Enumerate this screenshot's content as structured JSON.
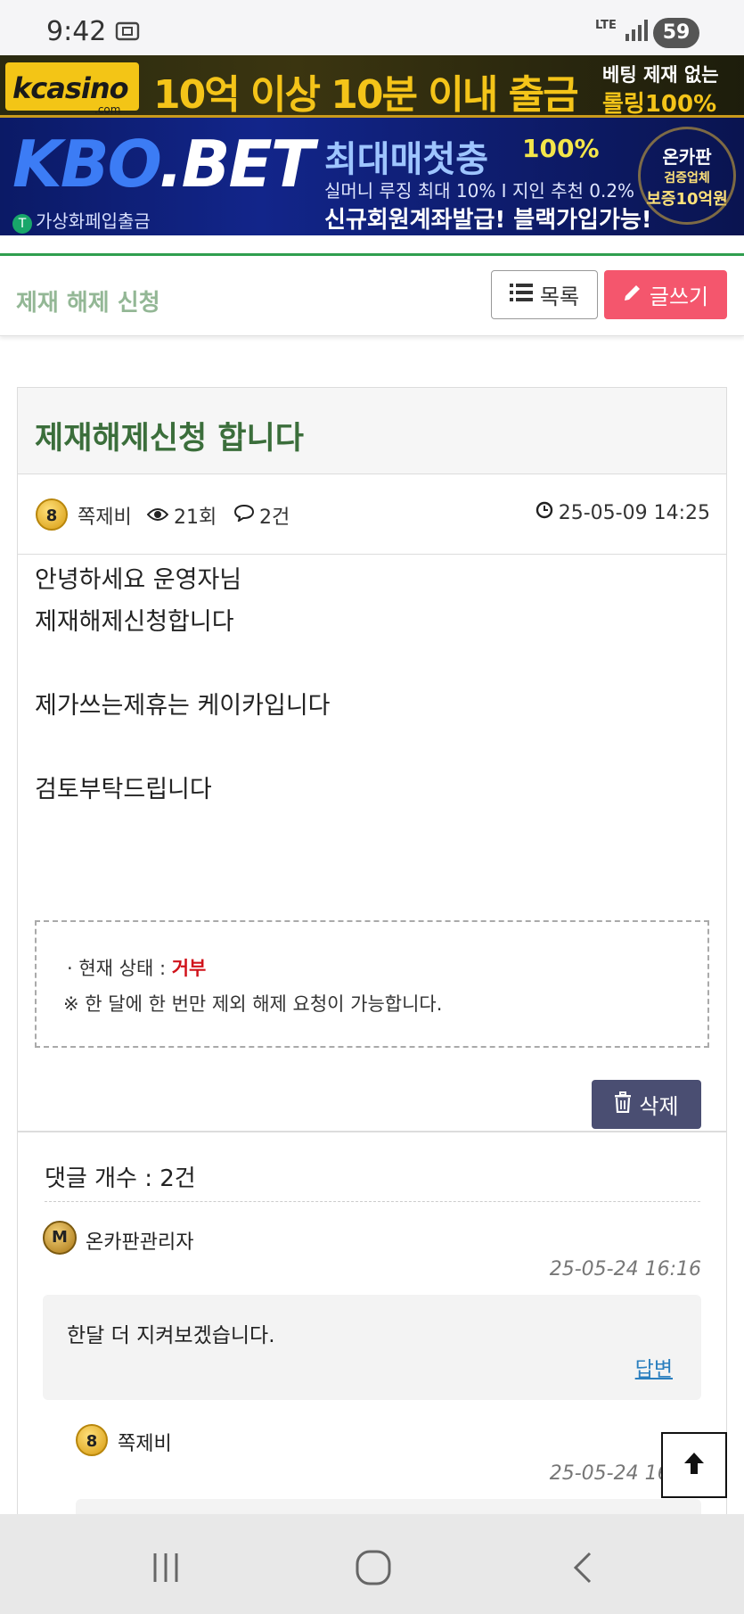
{
  "status_bar": {
    "time": "9:42",
    "network": "LTE",
    "battery": "59",
    "icons": [
      "screenshot-icon",
      "signal-icon"
    ]
  },
  "banners": {
    "top": {
      "logo": "kcasino",
      "logo_sub": ".com",
      "headline": "10억 이상 10분 이내 출금",
      "right_line1": "베팅 제재 없는",
      "right_line2": "롤링100%"
    },
    "second": {
      "brand_a": "KBO",
      "brand_b": ".BET",
      "tagline": "가상화페입출금",
      "headline": "최대매첫충",
      "percent": "100%",
      "subline": "실머니 루징 최대 10% I 지인 추천 0.2%",
      "cta": "신규회원계좌발급! 블랙가입가능!",
      "badge_line1": "온카판",
      "badge_line2": "검증업체",
      "badge_line3": "보증10억원"
    }
  },
  "board": {
    "title": "제재 해제 신청",
    "list_button": "목록",
    "write_button": "글쓰기"
  },
  "post": {
    "title": "제재해제신청 합니다",
    "author_level": "8",
    "author": "쪽제비",
    "views": "21회",
    "comments": "2건",
    "date": "25-05-09 14:25",
    "content_lines": [
      "안녕하세요 운영자님",
      "제재해제신청합니다",
      "",
      "제가쓰는제휴는 케이카입니다",
      "",
      "검토부탁드립니다"
    ],
    "status_label": "· 현재 상태 : ",
    "status_value": "거부",
    "status_note": "※ 한 달에 한 번만 제외 해제 요청이 가능합니다.",
    "delete_button": "삭제",
    "accent_red": "#d0121a"
  },
  "comments": {
    "count_label": "댓글 개수 : 2건",
    "items": [
      {
        "badge": "M",
        "author": "온카판관리자",
        "date": "25-05-24 16:16",
        "text": "한달 더 지켜보겠습니다.",
        "reply_label": "답변"
      },
      {
        "badge": "8",
        "author": "쪽제비",
        "date": "25-05-24 16:17",
        "text": ""
      }
    ]
  },
  "colors": {
    "title_green": "#3b6e3b",
    "write_pink": "#f4566d",
    "delete_navy": "#4a4e72",
    "reply_blue": "#2b7fbf"
  }
}
